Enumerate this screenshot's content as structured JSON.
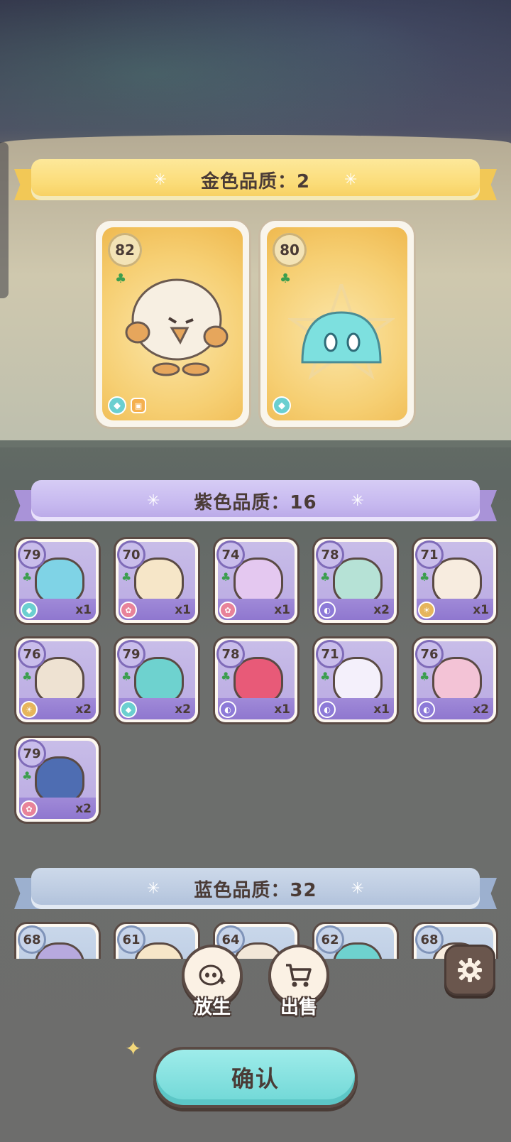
{
  "sections": {
    "gold": {
      "title": "金色品质：2"
    },
    "purple": {
      "title": "紫色品质：16"
    },
    "blue": {
      "title": "蓝色品质：32"
    }
  },
  "spark": "✳",
  "gold_cards": [
    {
      "level": "82",
      "creature": "white-yeti",
      "attr_icon": "water-gem-icon"
    },
    {
      "level": "80",
      "creature": "cyan-slime",
      "attr_icon": "water-gem-icon"
    }
  ],
  "purple_cards": [
    {
      "level": "79",
      "count": "x1",
      "attr": "water",
      "color": "#7fd3e6"
    },
    {
      "level": "70",
      "count": "x1",
      "attr": "flower",
      "color": "#f6e6c8"
    },
    {
      "level": "74",
      "count": "x1",
      "attr": "flower",
      "color": "#e4c8f0"
    },
    {
      "level": "78",
      "count": "x2",
      "attr": "dream",
      "color": "#b6e2d6"
    },
    {
      "level": "71",
      "count": "x1",
      "attr": "light",
      "color": "#f7ecdf"
    },
    {
      "level": "76",
      "count": "x2",
      "attr": "light",
      "color": "#eee2d2"
    },
    {
      "level": "79",
      "count": "x2",
      "attr": "water",
      "color": "#6ed2cf"
    },
    {
      "level": "78",
      "count": "x1",
      "attr": "dream",
      "color": "#e85a78"
    },
    {
      "level": "71",
      "count": "x1",
      "attr": "dream",
      "color": "#f4f0fb"
    },
    {
      "level": "76",
      "count": "x2",
      "attr": "dream",
      "color": "#f3c3d6"
    },
    {
      "level": "79",
      "count": "x2",
      "attr": "flower",
      "color": "#4e6db2"
    }
  ],
  "blue_cards": [
    {
      "level": "68",
      "color": "#b7a9de"
    },
    {
      "level": "61",
      "color": "#f6e6c8"
    },
    {
      "level": "64",
      "color": "#f2e7d8"
    },
    {
      "level": "62",
      "color": "#6ed2cf"
    },
    {
      "level": "68",
      "color": "#f7ecdf"
    }
  ],
  "actions": {
    "release_label": "放生",
    "sell_label": "出售",
    "confirm_label": "确认"
  },
  "colors": {
    "gold_accent": "#fbdc78",
    "purple_accent": "#c6b8ef",
    "blue_accent": "#bccbe1",
    "confirm": "#6fd7d6"
  }
}
